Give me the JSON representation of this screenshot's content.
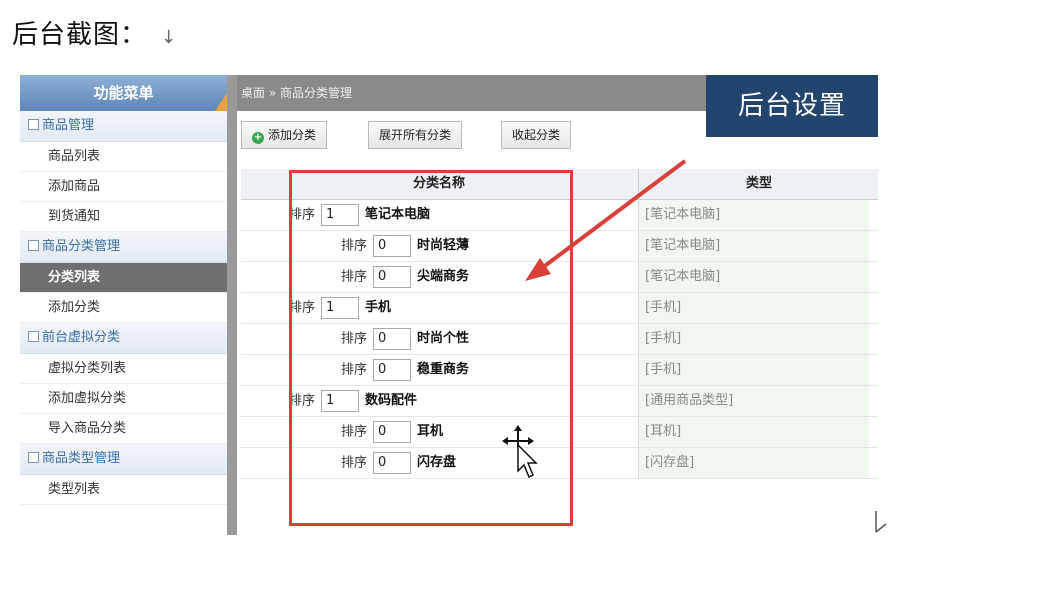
{
  "heading": "后台截图：",
  "heading_arrow": "↓",
  "sidebar": {
    "title": "功能菜单",
    "groups": [
      {
        "label": "商品管理",
        "items": [
          "商品列表",
          "添加商品",
          "到货通知"
        ]
      },
      {
        "label": "商品分类管理",
        "items": [
          "分类列表",
          "添加分类"
        ]
      },
      {
        "label": "前台虚拟分类",
        "items": [
          "虚拟分类列表",
          "添加虚拟分类",
          "导入商品分类"
        ]
      },
      {
        "label": "商品类型管理",
        "items": [
          "类型列表"
        ]
      }
    ],
    "active_item": "分类列表"
  },
  "breadcrumb": "桌面 » 商品分类管理",
  "toolbar": {
    "add": "添加分类",
    "expand": "展开所有分类",
    "collapse": "收起分类"
  },
  "banner": "后台设置",
  "table": {
    "headers": [
      "分类名称",
      "类型"
    ],
    "sort_label": "排序",
    "rows": [
      {
        "level": 0,
        "sort": "1",
        "name": "笔记本电脑",
        "type": "[笔记本电脑]"
      },
      {
        "level": 1,
        "sort": "0",
        "name": "时尚轻薄",
        "type": "[笔记本电脑]"
      },
      {
        "level": 1,
        "sort": "0",
        "name": "尖端商务",
        "type": "[笔记本电脑]"
      },
      {
        "level": 0,
        "sort": "1",
        "name": "手机",
        "type": "[手机]"
      },
      {
        "level": 1,
        "sort": "0",
        "name": "时尚个性",
        "type": "[手机]"
      },
      {
        "level": 1,
        "sort": "0",
        "name": "稳重商务",
        "type": "[手机]"
      },
      {
        "level": 0,
        "sort": "1",
        "name": "数码配件",
        "type": "[通用商品类型]"
      },
      {
        "level": 1,
        "sort": "0",
        "name": "耳机",
        "type": "[耳机]"
      },
      {
        "level": 1,
        "sort": "0",
        "name": "闪存盘",
        "type": "[闪存盘]"
      }
    ]
  },
  "colors": {
    "highlight": "#d9403a",
    "banner": "#23446c"
  }
}
